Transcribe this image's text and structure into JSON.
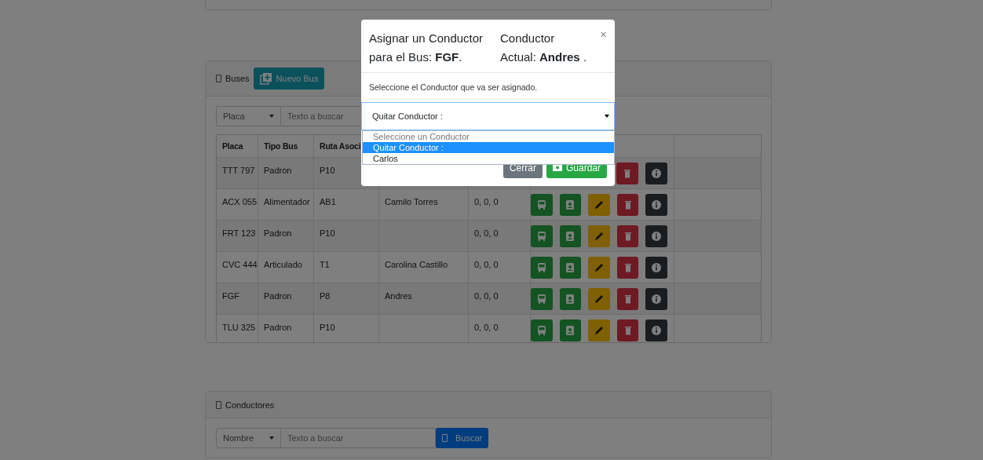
{
  "buses_panel": {
    "title": "Buses",
    "new_button": "Nuevo Bus",
    "filter": {
      "field": "Placa",
      "placeholder": "Texto a buscar"
    },
    "columns": [
      "Placa",
      "Tipo Bus",
      "Ruta Asoci"
    ],
    "rows": [
      {
        "cells": [
          "TTT 797",
          "Padron",
          "P10"
        ],
        "actions": [
          {
            "kind": "delete"
          },
          {
            "kind": "info"
          }
        ]
      },
      {
        "cells": [
          "ACX 055",
          "Alimentador",
          "AB1",
          "Camilo Torres",
          "0, 0, 0"
        ],
        "actions": [
          {
            "kind": "bus"
          },
          {
            "kind": "driver"
          },
          {
            "kind": "edit"
          },
          {
            "kind": "delete"
          },
          {
            "kind": "info"
          }
        ]
      },
      {
        "cells": [
          "FRT 123",
          "Padron",
          "P10",
          null,
          "0, 0, 0"
        ],
        "actions": [
          {
            "kind": "bus"
          },
          {
            "kind": "driver"
          },
          {
            "kind": "edit"
          },
          {
            "kind": "delete"
          },
          {
            "kind": "info"
          }
        ]
      },
      {
        "cells": [
          "CVC 444",
          "Articulado",
          "T1",
          "Carolina Castillo",
          "0, 0, 0"
        ],
        "actions": [
          {
            "kind": "bus"
          },
          {
            "kind": "driver"
          },
          {
            "kind": "edit"
          },
          {
            "kind": "delete"
          },
          {
            "kind": "info"
          }
        ]
      },
      {
        "cells": [
          "FGF",
          "Padron",
          "P8",
          "Andres",
          "0, 0, 0"
        ],
        "actions": [
          {
            "kind": "bus"
          },
          {
            "kind": "driver"
          },
          {
            "kind": "edit"
          },
          {
            "kind": "delete"
          },
          {
            "kind": "info"
          }
        ]
      },
      {
        "cells": [
          "TLU 325",
          "Padron",
          "P10",
          null,
          "0, 0, 0"
        ],
        "actions": [
          {
            "kind": "bus"
          },
          {
            "kind": "driver"
          },
          {
            "kind": "edit"
          },
          {
            "kind": "delete"
          },
          {
            "kind": "info"
          }
        ]
      }
    ]
  },
  "drivers_panel": {
    "title": "Conductores",
    "filter": {
      "field": "Nombre",
      "placeholder": "Texto a buscar"
    },
    "search_button": "Buscar"
  },
  "modal": {
    "title_left": "Asignar un Conductor para el Bus: **FGF**.",
    "title_right": "Conductor Actual: **Andres** .",
    "close": "×",
    "prompt": "Seleccione el Conductor que va ser asignado.",
    "select_value": "Quitar Conductor :",
    "options": [
      {
        "label": "Seleccione un Conductor",
        "selected": false,
        "disabled": true
      },
      {
        "label": "Quitar Conductor :",
        "selected": true,
        "disabled": false
      },
      {
        "label": "Carlos",
        "selected": false,
        "disabled": false
      }
    ],
    "buttons": [
      {
        "label": "Cerrar",
        "kind": "secondary"
      },
      {
        "label": "Guardar",
        "kind": "primary"
      }
    ]
  }
}
